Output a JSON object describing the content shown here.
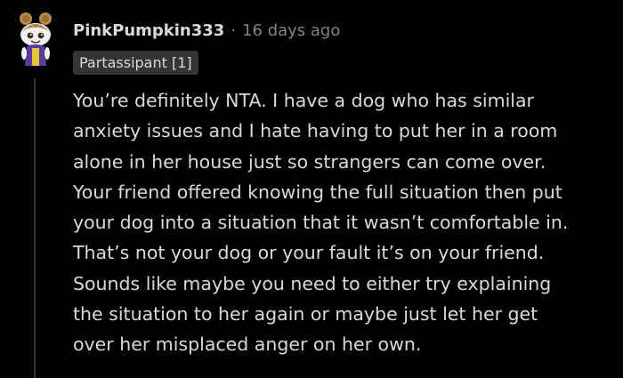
{
  "comment": {
    "author": {
      "username": "PinkPumpkin333",
      "flair": "Partassipant [1]"
    },
    "separator": "·",
    "timestamp": "16 days ago",
    "body_lines": [
      "You’re definitely NTA. I have a dog who has similar",
      "anxiety issues and I hate having to put her in a room",
      "alone in her house just so strangers can come over.",
      "Your friend offered knowing the full situation then put",
      "your dog into a situation that it wasn’t comfortable in.",
      "That’s not your dog or your fault it’s on your friend.",
      "Sounds like maybe you need to either try explaining",
      "the situation to her again or maybe just let her get",
      "over her misplaced anger on her own."
    ]
  },
  "icons": {
    "avatar": "snoo-avatar-icon"
  },
  "colors": {
    "background": "#000000",
    "text": "#d7dadc",
    "meta": "#818384",
    "flair_bg": "#343536",
    "thread_line": "#343536"
  }
}
